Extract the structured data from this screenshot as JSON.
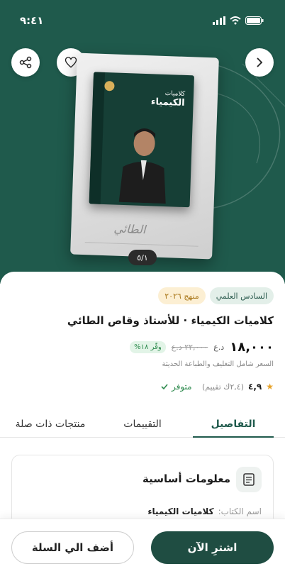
{
  "status_bar": {
    "time": "٩:٤١"
  },
  "gallery": {
    "pager": "٥/١"
  },
  "book_cover": {
    "title_small": "كلاميات",
    "title_big": "الكيمياء",
    "signature": "الطائي"
  },
  "product": {
    "badges": [
      "السادس العلمي",
      "منهج ٢٠٢٦"
    ],
    "title": "كلاميات الكيمياء · للأستاذ وقاص الطائي",
    "price": "١٨,٠٠٠",
    "currency": "د.ع",
    "old_price": "٢٢,٠٠٠ د.ع",
    "save_label": "وفّر ١٨%",
    "price_note": "السعر شامل التغليف والطباعة الحديثة",
    "rating": "٤,٩",
    "rating_count": "(٢,٤ك تقييم)",
    "stock": "متوفر"
  },
  "tabs": [
    "التفاصيل",
    "التقييمات",
    "منتجات ذات صلة"
  ],
  "info": {
    "title": "معلومات أساسية",
    "rows": [
      {
        "key": "اسم الكتاب:",
        "value": "كلاميات الكيمياء"
      }
    ]
  },
  "actions": {
    "buy": "اشترِ الآن",
    "add_to_cart": "أضف الي السلة"
  },
  "colors": {
    "primary": "#1f5a4c",
    "accent": "#e7a32a",
    "success": "#2d8a4d"
  },
  "icons": [
    "share-icon",
    "heart-icon",
    "chevron-right-icon",
    "signal-icon",
    "wifi-icon",
    "battery-icon",
    "star-icon",
    "check-icon",
    "document-icon"
  ]
}
